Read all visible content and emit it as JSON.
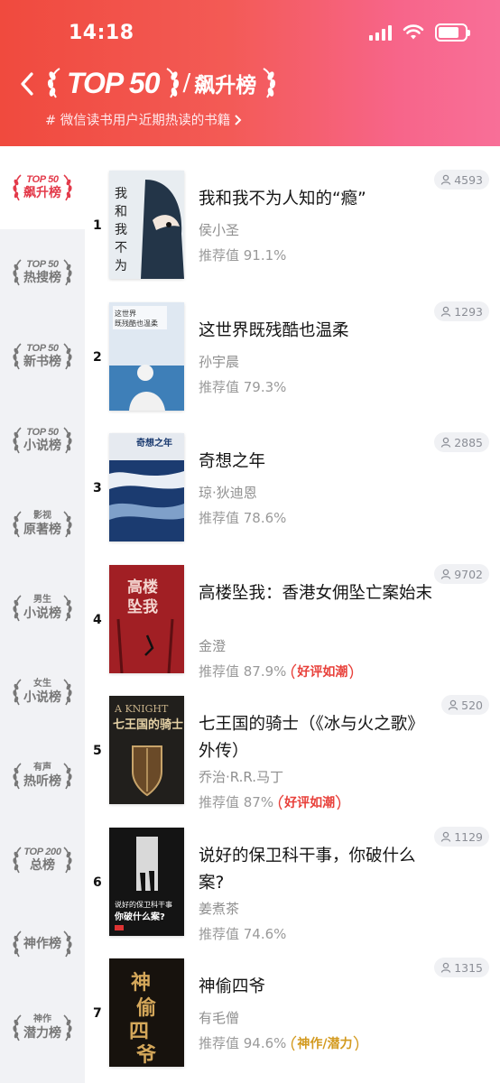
{
  "status_bar": {
    "time": "14:18"
  },
  "header": {
    "logo_text": "TOP 50",
    "separator": "/",
    "rank_title": "飙升榜",
    "subtitle": "# 微信读书用户近期热读的书籍",
    "gradient": [
      "#f04a3e",
      "#f86f98"
    ]
  },
  "sidebar": {
    "items": [
      {
        "top": "TOP 50",
        "main": "飙升榜",
        "active": true
      },
      {
        "top": "TOP 50",
        "main": "热搜榜",
        "active": false
      },
      {
        "top": "TOP 50",
        "main": "新书榜",
        "active": false
      },
      {
        "top": "TOP 50",
        "main": "小说榜",
        "active": false
      },
      {
        "top": "影视",
        "main": "原著榜",
        "active": false
      },
      {
        "top": "男生",
        "main": "小说榜",
        "active": false
      },
      {
        "top": "女生",
        "main": "小说榜",
        "active": false
      },
      {
        "top": "有声",
        "main": "热听榜",
        "active": false
      },
      {
        "top": "TOP 200",
        "main": "总榜",
        "active": false
      },
      {
        "top": "",
        "main": "神作榜",
        "active": false
      },
      {
        "top": "神作",
        "main": "潜力榜",
        "active": false
      }
    ],
    "active_color": "#e33a4a"
  },
  "books": [
    {
      "rank": "1",
      "title": "我和我不为人知的“瘾”",
      "author": "侯小圣",
      "score": "推荐值 91.1%",
      "readers": "4593",
      "tag": ""
    },
    {
      "rank": "2",
      "title": "这世界既残酷也温柔",
      "author": "孙宇晨",
      "score": "推荐值 79.3%",
      "readers": "1293",
      "tag": ""
    },
    {
      "rank": "3",
      "title": "奇想之年",
      "author": "琼·狄迪恩",
      "score": "推荐值 78.6%",
      "readers": "2885",
      "tag": ""
    },
    {
      "rank": "4",
      "title": "高楼坠我：香港女佣坠亡案始末",
      "author": "金澄",
      "score": "推荐值 87.9%",
      "readers": "9702",
      "tag": "好评如潮"
    },
    {
      "rank": "5",
      "title": "七王国的骑士（《冰与火之歌》外传）",
      "author": "乔治·R.R.马丁",
      "score": "推荐值 87%",
      "readers": "520",
      "tag": "好评如潮"
    },
    {
      "rank": "6",
      "title": "说好的保卫科干事，你破什么案?",
      "author": "姜煮茶",
      "score": "推荐值 74.6%",
      "readers": "1129",
      "tag": ""
    },
    {
      "rank": "7",
      "title": "神偷四爷",
      "author": "有毛僧",
      "score": "推荐值 94.6%",
      "readers": "1315",
      "tag": "神作/潜力"
    }
  ],
  "covers": [
    {
      "text": "我和我不为人知的“瘾”",
      "bg": "#e9eef2"
    },
    {
      "text": "这世界既残酷也温柔",
      "bg": "#d9e4ef"
    },
    {
      "text": "奇想之年",
      "bg": "#1c3f74"
    },
    {
      "text": "高楼坠我",
      "bg": "#a01f24"
    },
    {
      "text": "七王国的骑士",
      "bg": "#22201d"
    },
    {
      "text": "说好的保卫科干事 你破什么案?",
      "bg": "#1b1b1b"
    },
    {
      "text": "神偷四爷",
      "bg": "#17120d"
    }
  ]
}
